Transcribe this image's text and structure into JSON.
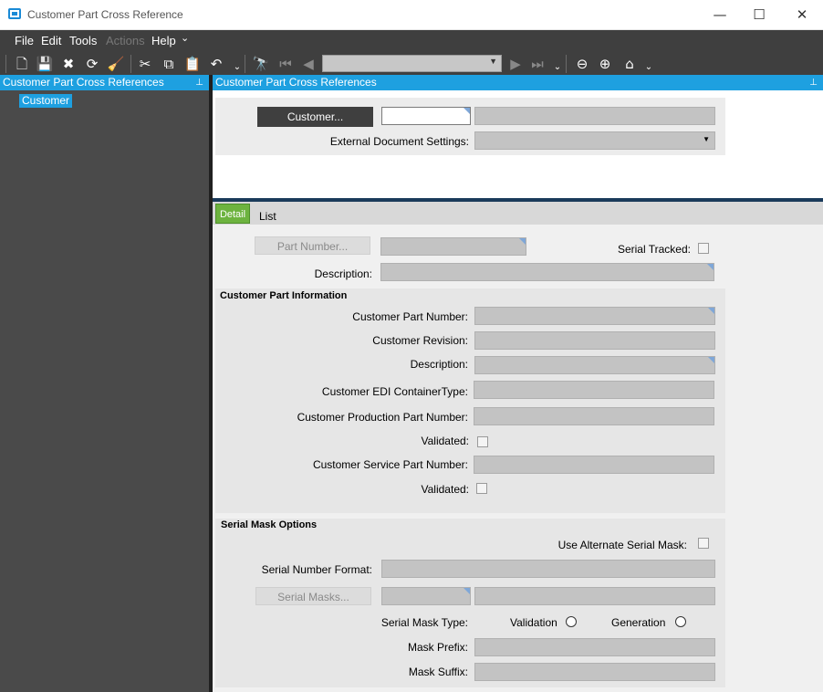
{
  "window": {
    "title": "Customer Part Cross Reference",
    "minimize_glyph": "—",
    "maximize_glyph": "☐",
    "close_glyph": "✕"
  },
  "menubar": {
    "items": [
      "File",
      "Edit",
      "Tools",
      "Actions",
      "Help"
    ],
    "help_dropdown_glyph": "⌄"
  },
  "toolbar": {
    "icons": [
      "new-icon",
      "save-icon",
      "delete-icon",
      "refresh-icon",
      "clear-icon",
      "cut-icon",
      "copy-icon",
      "paste-icon",
      "undo-icon",
      "search-icon",
      "first-record-icon",
      "previous-record-icon",
      "next-record-icon",
      "last-record-icon",
      "back-icon",
      "forward-icon",
      "home-icon"
    ],
    "glyphs": {
      "new": "🗋",
      "save": "💾",
      "delete": "✖",
      "refresh": "⟳",
      "clear": "🧹",
      "cut": "✂",
      "copy": "⧉",
      "paste": "📋",
      "undo": "↶",
      "search": "🔭",
      "first": "⏮",
      "prev": "◀",
      "next": "▶",
      "last": "⏭",
      "back": "⊖",
      "forward": "⊕",
      "home": "⌂",
      "dropdown": "⌄",
      "combo_arrow": "▼"
    }
  },
  "left_panel": {
    "header": "Customer Part Cross References",
    "pin_glyph": "⊥",
    "tree": [
      "Customer"
    ]
  },
  "right_panel": {
    "header": "Customer Part Cross References",
    "pin_glyph": "⊥",
    "customer_button": "Customer...",
    "external_document_settings_label": "External Document Settings:",
    "dropdown_arrow": "▼",
    "tabs": [
      {
        "label": "Detail",
        "active": true
      },
      {
        "label": "List",
        "active": false
      }
    ],
    "detail": {
      "part_number_button": "Part Number...",
      "serial_tracked_label": "Serial Tracked:",
      "description_label": "Description:",
      "customer_part_info": {
        "title": "Customer Part Information",
        "customer_part_number_label": "Customer Part Number:",
        "customer_revision_label": "Customer Revision:",
        "description_label": "Description:",
        "edi_container_type_label": "Customer EDI ContainerType:",
        "production_part_number_label": "Customer Production Part Number:",
        "validated_label_1": "Validated:",
        "service_part_number_label": "Customer Service Part Number:",
        "validated_label_2": "Validated:"
      },
      "serial_mask_options": {
        "title": "Serial Mask Options",
        "use_alternate_serial_mask_label": "Use Alternate Serial Mask:",
        "serial_number_format_label": "Serial Number Format:",
        "serial_masks_button": "Serial Masks...",
        "serial_mask_type_label": "Serial Mask Type:",
        "validation_label": "Validation",
        "generation_label": "Generation",
        "mask_prefix_label": "Mask Prefix:",
        "mask_suffix_label": "Mask Suffix:"
      }
    }
  },
  "colors": {
    "accent_blue": "#1ea0e0",
    "active_tab_green": "#6db33f",
    "toolbar_dark": "#3f3f3f"
  }
}
